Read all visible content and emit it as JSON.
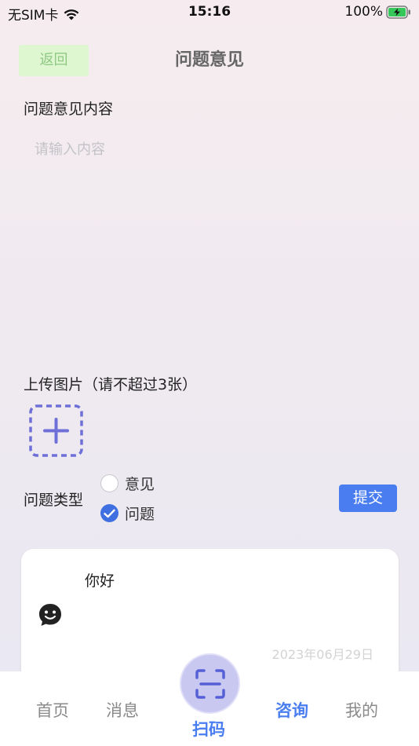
{
  "status_bar": {
    "carrier": "无SIM卡",
    "time": "15:16",
    "battery": "100%"
  },
  "header": {
    "back_label": "返回",
    "title": "问题意见"
  },
  "form": {
    "content_label": "问题意见内容",
    "content_placeholder": "请输入内容",
    "content_value": "",
    "upload_label": "上传图片（请不超过3张）",
    "type_label": "问题类型",
    "type_options": [
      {
        "label": "意见",
        "checked": false
      },
      {
        "label": "问题",
        "checked": true
      }
    ],
    "submit_label": "提交"
  },
  "card": {
    "text": "你好",
    "icon": "chat-bubble-smile-icon",
    "date": "2023年06月29日"
  },
  "tabbar": {
    "home": "首页",
    "messages": "消息",
    "scan": "扫码",
    "consult": "咨询",
    "mine": "我的",
    "active": "consult"
  },
  "colors": {
    "accent": "#4a7ef0",
    "back_bg": "#dff7d1",
    "upload_border": "#6f6fd8"
  }
}
